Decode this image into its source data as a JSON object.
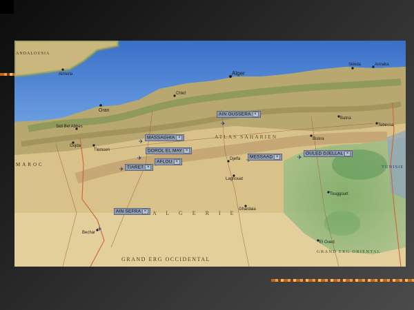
{
  "map": {
    "region_labels": {
      "atlas": "ATLAS SAHARIEN",
      "algerie": "A L G E R I E",
      "grand_erg_occidental": "GRAND ERG OCCIDENTAL",
      "grand_erg_oriental": "GRAND ERG ORIENTAL",
      "maroc": "MAROC",
      "tunisie": "TUNISIE",
      "andalousia": "ANDALOUSIA"
    },
    "cities": [
      {
        "name": "Alger"
      },
      {
        "name": "Oran"
      },
      {
        "name": "Skikda"
      },
      {
        "name": "Annaba"
      },
      {
        "name": "Tlemcen"
      },
      {
        "name": "Oujda"
      },
      {
        "name": "Almeria"
      },
      {
        "name": "Chlef"
      },
      {
        "name": "Biskra"
      },
      {
        "name": "Batna"
      },
      {
        "name": "Djelfa"
      },
      {
        "name": "Laghouat"
      },
      {
        "name": "Ghardaia"
      },
      {
        "name": "Touggourt"
      },
      {
        "name": "El Oued"
      },
      {
        "name": "Bechar"
      },
      {
        "name": "Sidi Bel Abbes"
      },
      {
        "name": "Tebessa"
      }
    ],
    "markers": [
      {
        "label": "AIN OUSSERA"
      },
      {
        "label": "MASSAGHIA"
      },
      {
        "label": "DOROL EL MAY"
      },
      {
        "label": "AFLOU"
      },
      {
        "label": "TIARET"
      },
      {
        "label": "MESSAAD"
      },
      {
        "label": "OULED DJELLAL"
      },
      {
        "label": "AIN SEFRA"
      }
    ],
    "close_glyph": "×",
    "pin_glyph": "✈"
  }
}
